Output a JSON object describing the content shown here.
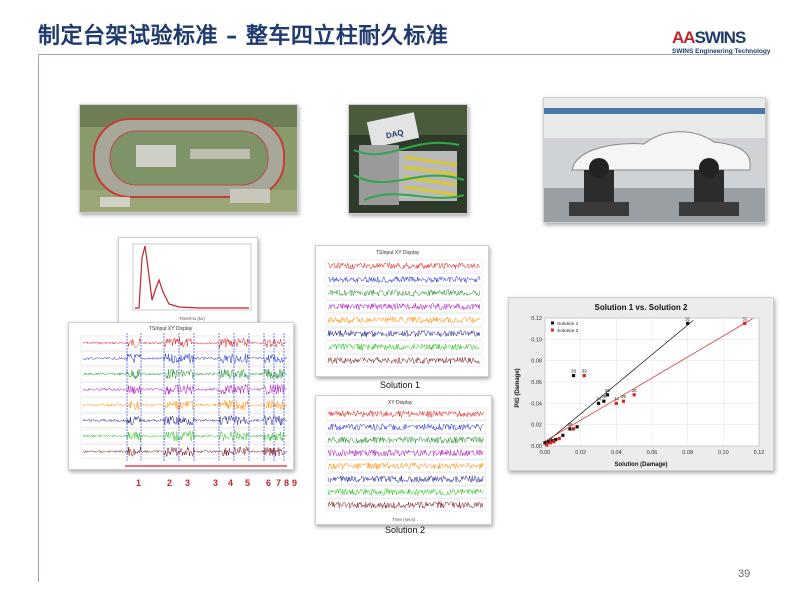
{
  "header": {
    "title": "制定台架试验标准 – 整车四立柱耐久标准",
    "logo_text_a": "AA",
    "logo_text_b": "SWINS",
    "logo_subtitle": "SWINS Engineering Technology"
  },
  "images": {
    "track_photo": "proving-ground aerial photo",
    "daq_photo": "data acquisition hardware photo",
    "rig_photo": "four-post test rig with white car photo"
  },
  "histogram": {
    "title": "",
    "xlabel": "Time/ms (kx)"
  },
  "tsinput": {
    "title": "TSInput XY Display",
    "segment_numbers": [
      "1",
      "2",
      "3",
      "3",
      "4",
      "5",
      "6",
      "7",
      "8",
      "9"
    ]
  },
  "solution1": {
    "title": "TSInput XY Display",
    "caption": "Solution 1"
  },
  "solution2": {
    "title": "XY Display",
    "caption": "Solution 2",
    "xlabel": "Time (secs)"
  },
  "scatter": {
    "title": "Solution 1 vs. Solution 2",
    "xlabel": "Solution (Damage)",
    "ylabel": "PiG (Damage)",
    "legend": [
      "Solution 1",
      "Solution 2"
    ]
  },
  "chart_data": {
    "type": "scatter",
    "title": "Solution 1 vs. Solution 2",
    "xlabel": "Solution (Damage)",
    "ylabel": "PiG (Damage)",
    "xlim": [
      0,
      0.12
    ],
    "ylim": [
      0,
      0.12
    ],
    "x_ticks": [
      "0.00",
      "0.02",
      "0.04",
      "0.06",
      "0.08",
      "0.10",
      "0.12"
    ],
    "y_ticks": [
      "0.00",
      "0.02",
      "0.04",
      "0.06",
      "0.08",
      "0.10",
      "0.12"
    ],
    "legend_position": "top-left",
    "grid": true,
    "series": [
      {
        "name": "Solution 1",
        "color": "#111111",
        "x": [
          0.0,
          0.002,
          0.004,
          0.006,
          0.01,
          0.014,
          0.018,
          0.03,
          0.033,
          0.035,
          0.016,
          0.08
        ],
        "y": [
          0.003,
          0.004,
          0.005,
          0.006,
          0.01,
          0.016,
          0.018,
          0.04,
          0.042,
          0.048,
          0.066,
          0.115
        ],
        "labels": [
          "",
          "",
          "",
          "",
          "",
          "38",
          "",
          "34",
          "35",
          "35",
          "39",
          "31"
        ]
      },
      {
        "name": "Solution 2",
        "color": "#e0201d",
        "x": [
          0.001,
          0.003,
          0.005,
          0.008,
          0.016,
          0.022,
          0.04,
          0.044,
          0.05,
          0.112
        ],
        "y": [
          0.001,
          0.003,
          0.004,
          0.007,
          0.016,
          0.066,
          0.04,
          0.042,
          0.048,
          0.115
        ],
        "labels": [
          "",
          "",
          "",
          "",
          "",
          "39",
          "34",
          "35",
          "35",
          "31"
        ]
      }
    ]
  },
  "footer": {
    "page_number": "39"
  }
}
